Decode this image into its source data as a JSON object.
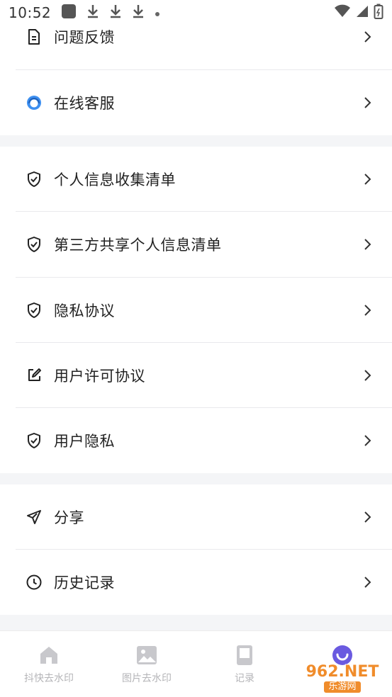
{
  "status_bar": {
    "time": "10:52"
  },
  "groups": {
    "support": {
      "items": [
        {
          "label": "问题反馈",
          "icon": "document-icon"
        },
        {
          "label": "在线客服",
          "icon": "customer-service-icon"
        }
      ]
    },
    "privacy": {
      "items": [
        {
          "label": "个人信息收集清单",
          "icon": "shield-check-icon"
        },
        {
          "label": "第三方共享个人信息清单",
          "icon": "shield-check-icon"
        },
        {
          "label": "隐私协议",
          "icon": "shield-check-icon"
        },
        {
          "label": "用户许可协议",
          "icon": "edit-icon"
        },
        {
          "label": "用户隐私",
          "icon": "shield-check-icon"
        }
      ]
    },
    "other": {
      "items": [
        {
          "label": "分享",
          "icon": "send-icon"
        },
        {
          "label": "历史记录",
          "icon": "clock-icon"
        }
      ]
    }
  },
  "tabbar": {
    "tabs": [
      {
        "label": "抖快去水印",
        "icon": "home-icon"
      },
      {
        "label": "图片去水印",
        "icon": "image-icon"
      },
      {
        "label": "记录",
        "icon": "record-icon"
      },
      {
        "label": "",
        "icon": "profile-icon"
      }
    ]
  },
  "watermark": {
    "top": "962.NET",
    "bottom": "乐游网"
  },
  "colors": {
    "accent": "#6a5ae0",
    "service_blue": "#3d8ff0",
    "background": "#f4f5f7"
  }
}
